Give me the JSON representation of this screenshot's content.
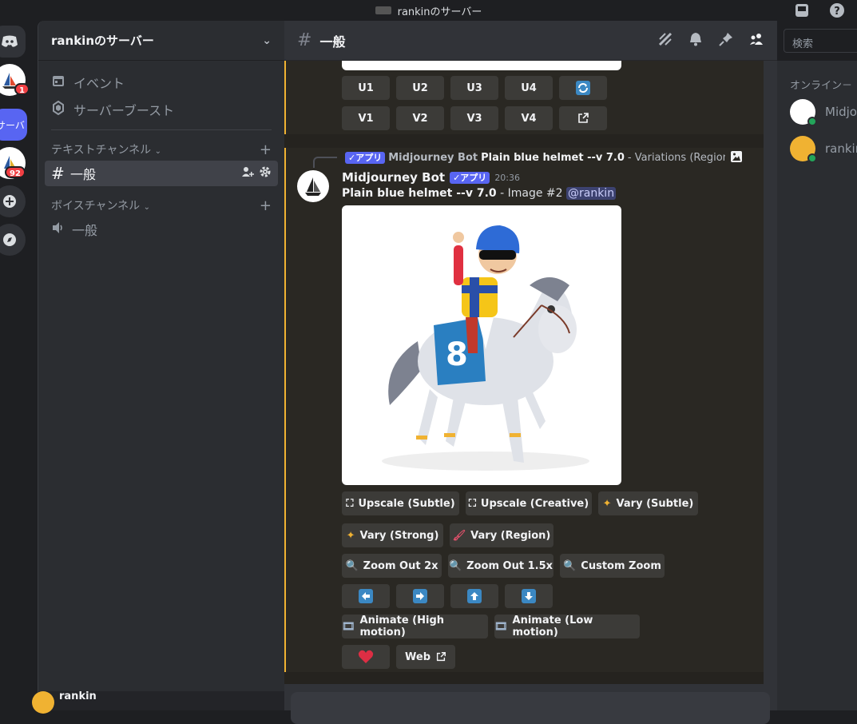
{
  "window": {
    "title": "rankinのサーバー"
  },
  "servers": {
    "badge1": "1",
    "badge2": "92",
    "active_label": "サーバ"
  },
  "sidebar": {
    "server_name": "rankinのサーバー",
    "events": "イベント",
    "boost": "サーバーブースト",
    "text_category": "テキストチャンネル",
    "voice_category": "ボイスチャンネル",
    "text_channel": "一般",
    "voice_channel": "一般",
    "user_name": "rankin"
  },
  "channel": {
    "name": "一般",
    "search_placeholder": "検索"
  },
  "prev_buttons": {
    "row1": [
      "U1",
      "U2",
      "U3",
      "U4"
    ],
    "row2": [
      "V1",
      "V2",
      "V3",
      "V4"
    ]
  },
  "reply": {
    "tag": "✓アプリ",
    "author": "Midjourney Bot",
    "prompt": "Plain blue helmet --v 7.0",
    "rest": " - Variations (Region) b..."
  },
  "message": {
    "author": "Midjourney Bot",
    "tag": "✓アプリ",
    "time": "20:36",
    "prompt": "Plain blue helmet --v 7.0",
    "suffix": " - Image #2 ",
    "mention": "@rankin"
  },
  "buttons": {
    "upscale_subtle": "Upscale (Subtle)",
    "upscale_creative": "Upscale (Creative)",
    "vary_subtle": "Vary (Subtle)",
    "vary_strong": "Vary (Strong)",
    "vary_region": "Vary (Region)",
    "zoom_out_2x": "Zoom Out 2x",
    "zoom_out_15x": "Zoom Out 1.5x",
    "custom_zoom": "Custom Zoom",
    "animate_high": "Animate (High motion)",
    "animate_low": "Animate (Low motion)",
    "web": "Web"
  },
  "members": {
    "category": "オンライン－",
    "member1": "Midjo",
    "member2": "rankin"
  },
  "colors": {
    "accent": "#5865f2",
    "highlight_bar": "#f0b232",
    "online": "#23a55a"
  }
}
